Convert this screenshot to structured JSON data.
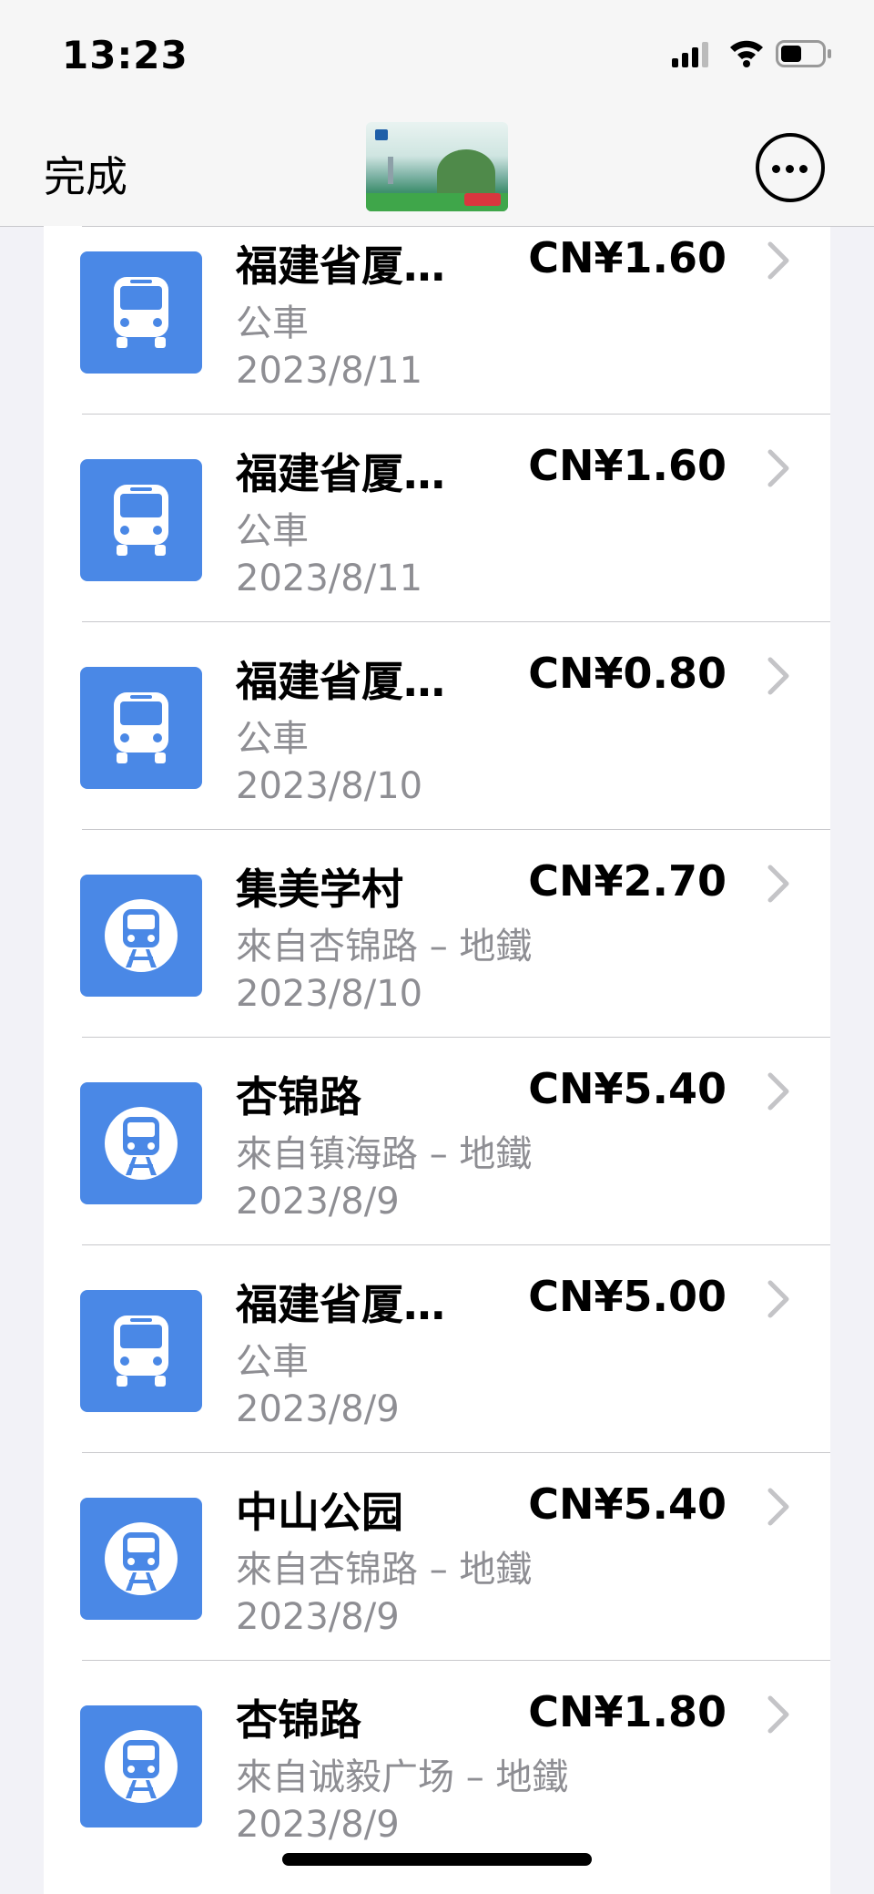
{
  "status_bar": {
    "time": "13:23",
    "signal_icon": "cellular-signal-icon",
    "wifi_icon": "wifi-icon",
    "battery_icon": "battery-icon",
    "battery_level": 0.45
  },
  "nav": {
    "done_label": "完成",
    "card_image": "transit-card-thumbnail",
    "more_icon": "more-options-icon"
  },
  "colors": {
    "icon_bg": "#4a88e6",
    "secondary_text": "#8e8e93",
    "separator": "#c8c8cc"
  },
  "transactions": [
    {
      "type": "bus",
      "icon": "bus-icon",
      "title": "福建省厦…",
      "amount": "CN¥1.60",
      "subtitle": "公車",
      "date": "2023/8/11"
    },
    {
      "type": "bus",
      "icon": "bus-icon",
      "title": "福建省厦…",
      "amount": "CN¥1.60",
      "subtitle": "公車",
      "date": "2023/8/11"
    },
    {
      "type": "bus",
      "icon": "bus-icon",
      "title": "福建省厦…",
      "amount": "CN¥0.80",
      "subtitle": "公車",
      "date": "2023/8/10"
    },
    {
      "type": "metro",
      "icon": "metro-icon",
      "title": "集美学村",
      "amount": "CN¥2.70",
      "subtitle": "來自杏锦路 – 地鐵",
      "date": "2023/8/10"
    },
    {
      "type": "metro",
      "icon": "metro-icon",
      "title": "杏锦路",
      "amount": "CN¥5.40",
      "subtitle": "來自镇海路 – 地鐵",
      "date": "2023/8/9"
    },
    {
      "type": "bus",
      "icon": "bus-icon",
      "title": "福建省厦…",
      "amount": "CN¥5.00",
      "subtitle": "公車",
      "date": "2023/8/9"
    },
    {
      "type": "metro",
      "icon": "metro-icon",
      "title": "中山公园",
      "amount": "CN¥5.40",
      "subtitle": "來自杏锦路 – 地鐵",
      "date": "2023/8/9"
    },
    {
      "type": "metro",
      "icon": "metro-icon",
      "title": "杏锦路",
      "amount": "CN¥1.80",
      "subtitle": "來自诚毅广场 – 地鐵",
      "date": "2023/8/9"
    }
  ]
}
